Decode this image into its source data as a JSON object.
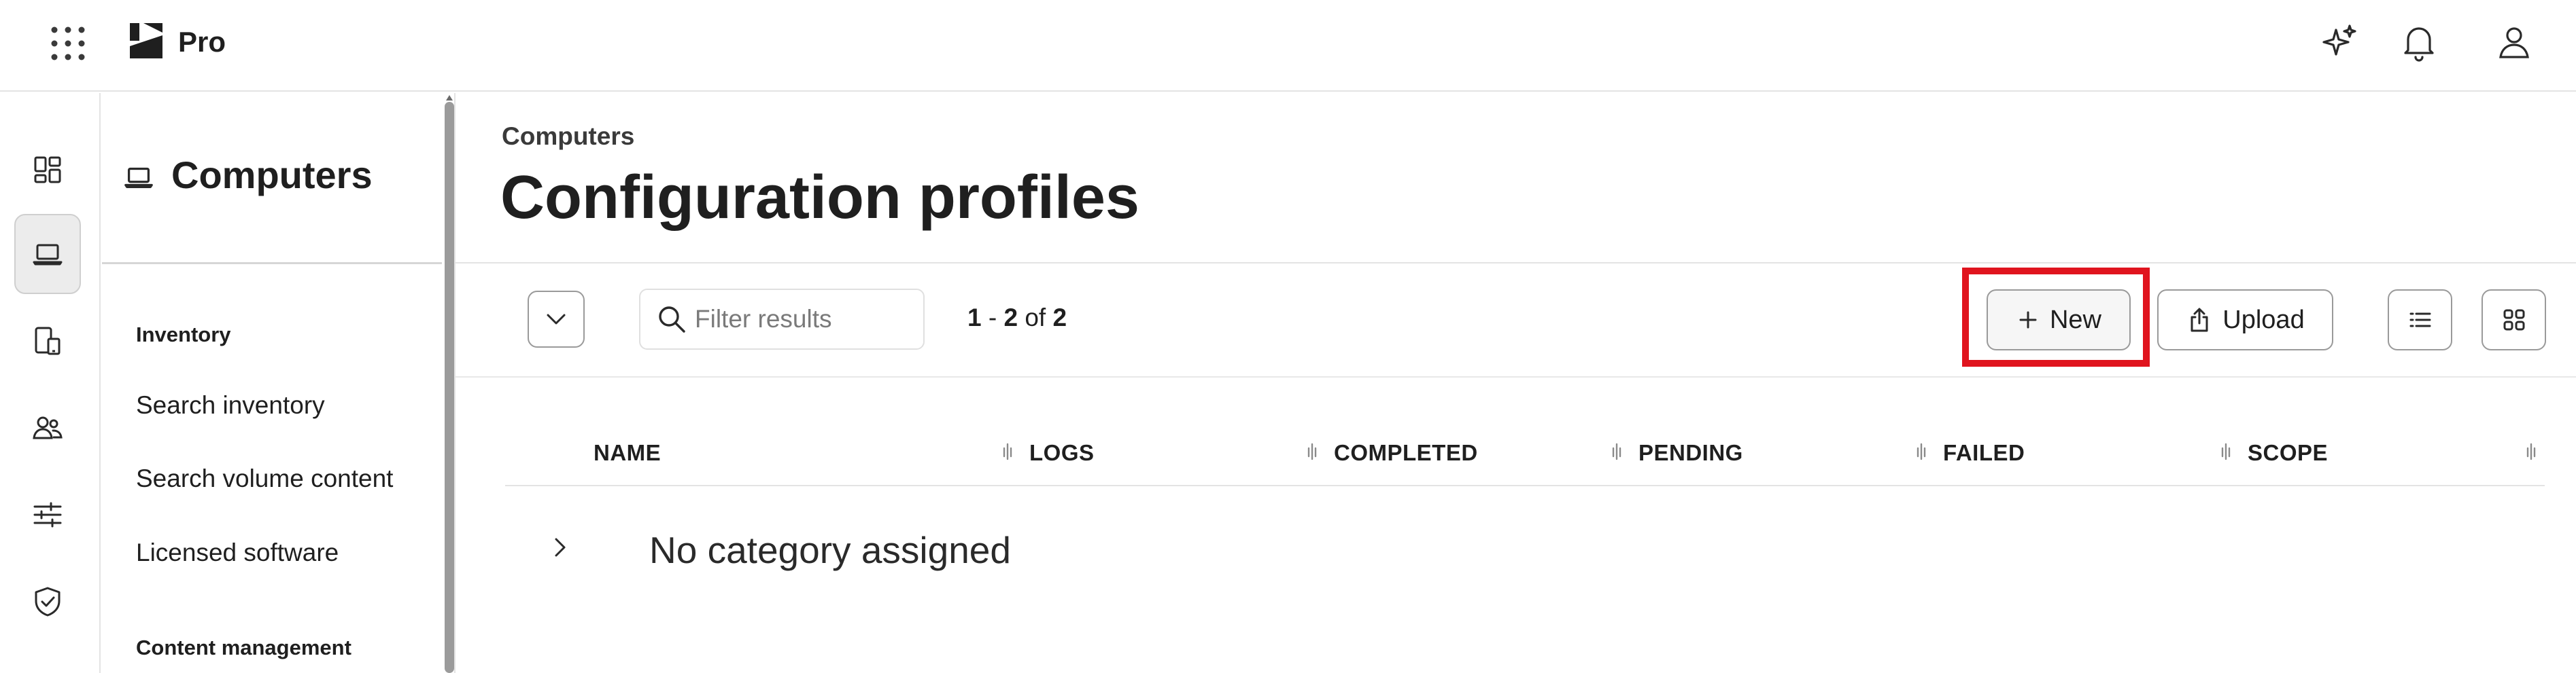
{
  "app": {
    "brand": "Pro"
  },
  "sidebar": {
    "title": "Computers",
    "groups": [
      {
        "label": "Inventory",
        "items": [
          "Search inventory",
          "Search volume content",
          "Licensed software"
        ]
      },
      {
        "label": "Content management",
        "items": []
      }
    ]
  },
  "main": {
    "breadcrumb": "Computers",
    "title": "Configuration profiles",
    "filter": {
      "placeholder": "Filter results",
      "value": ""
    },
    "pager": {
      "start": "1",
      "sep": " - ",
      "end": "2",
      "of": " of ",
      "total": "2"
    },
    "actions": {
      "new_label": "New",
      "upload_label": "Upload"
    },
    "table": {
      "columns": [
        "NAME",
        "LOGS",
        "COMPLETED",
        "PENDING",
        "FAILED",
        "SCOPE"
      ],
      "categories": [
        {
          "label": "No category assigned"
        }
      ]
    }
  },
  "colors": {
    "highlight": "#e0141e",
    "active_rail": "#ececec"
  }
}
